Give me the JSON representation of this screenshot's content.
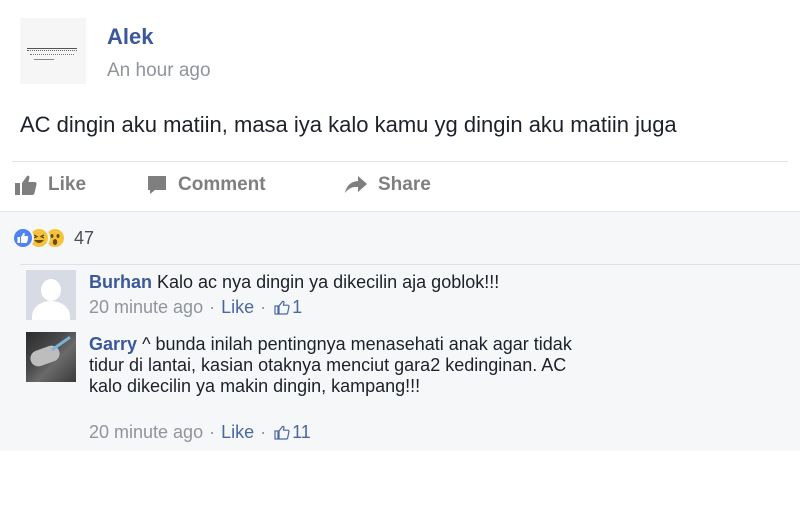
{
  "post": {
    "author": "Alek",
    "time": "An hour ago",
    "text": "AC dingin aku matiin, masa iya kalo kamu yg dingin aku matiin juga"
  },
  "actions": {
    "like": "Like",
    "comment": "Comment",
    "share": "Share"
  },
  "reactions": {
    "icons": [
      "like-icon",
      "haha-icon",
      "wow-icon"
    ],
    "count": "47"
  },
  "comments": [
    {
      "name": "Burhan",
      "text": "Kalo ac nya dingin ya dikecilin aja goblok!!!",
      "time": "20 minute ago",
      "like_label": "Like",
      "likes": "1"
    },
    {
      "name": "Garry",
      "text": "^ bunda inilah pentingnya menasehati anak agar tidak tidur di lantai, kasian otaknya menciut gara2 kedinginan. AC kalo dikecilin ya makin dingin, kampang!!!",
      "time": "20 minute ago",
      "like_label": "Like",
      "likes": "11"
    }
  ],
  "colors": {
    "link": "#3b5998",
    "muted": "#90949c",
    "action": "#7f7f7f",
    "comments_bg": "#f6f7f9"
  }
}
